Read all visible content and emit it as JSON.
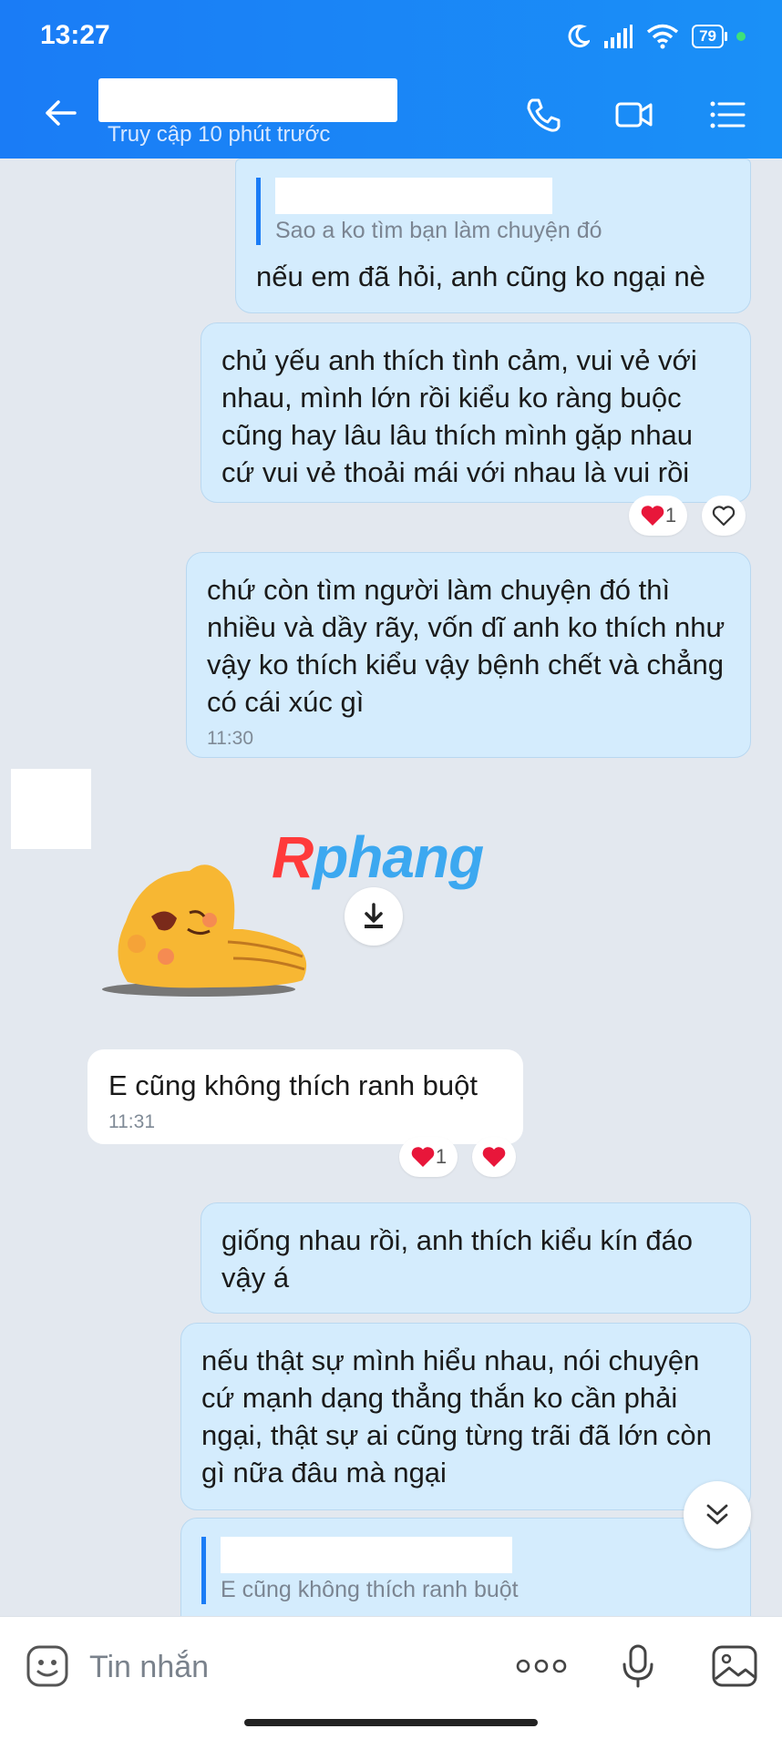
{
  "status_bar": {
    "time": "13:27",
    "battery": "79"
  },
  "header": {
    "subtitle": "Truy cập 10 phút trước"
  },
  "messages": [
    {
      "quote": "Sao a ko tìm bạn làm chuyện đó",
      "text": "nếu em đã hỏi, anh cũng ko ngại nè"
    },
    {
      "text": "chủ yếu anh thích tình cảm, vui vẻ với nhau, mình lớn rồi kiểu ko ràng buộc cũng hay lâu lâu thích mình gặp nhau cứ vui vẻ thoải mái với nhau là vui rồi",
      "reaction_count": "1"
    },
    {
      "text": "chứ còn tìm người làm chuyện đó thì nhiều và dầy rãy, vốn dĩ anh ko thích như vậy ko thích kiểu vậy bệnh chết và chẳng có cái xúc gì",
      "time": "11:30"
    },
    {
      "text": "E cũng không thích ranh buột",
      "time": "11:31",
      "reaction_count": "1"
    },
    {
      "text": "giống nhau rồi, anh thích kiểu kín đáo vậy á"
    },
    {
      "text": "nếu thật sự mình hiểu nhau, nói chuyện cứ mạnh dạng thẳng thắn ko cần phải ngại, thật sự ai cũng từng trãi đã lớn còn gì nữa đâu mà ngại"
    },
    {
      "quote": "E cũng không thích ranh buột"
    }
  ],
  "watermark": {
    "part1": "R",
    "part2": "phang"
  },
  "input": {
    "placeholder": "Tin nhắn"
  },
  "colors": {
    "header": "#1a7cf6",
    "bubble_sent": "#d4ecfd",
    "bubble_received": "#ffffff",
    "reaction_heart": "#e8163a"
  }
}
